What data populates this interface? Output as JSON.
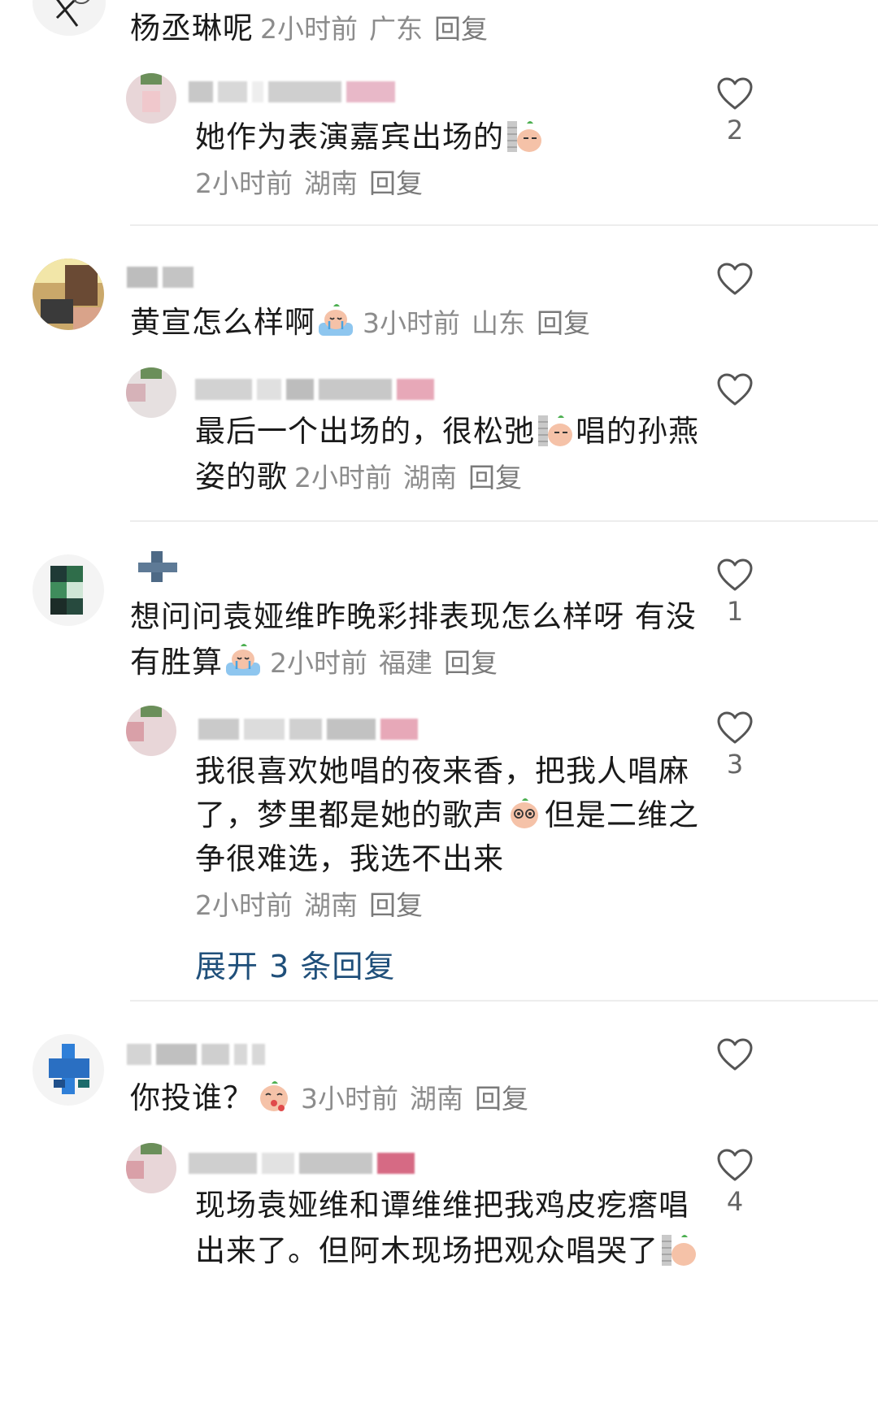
{
  "comments": [
    {
      "id": "c0",
      "text": "杨丞琳呢",
      "time": "2小时前",
      "location": "广东",
      "reply_label": "回复"
    },
    {
      "id": "r0",
      "text": "她作为表演嘉宾出场的",
      "emoji": "wall-peek-emoji",
      "time": "2小时前",
      "location": "湖南",
      "reply_label": "回复",
      "likes": "2"
    },
    {
      "id": "c1",
      "text": "黄宣怎么样啊",
      "emoji": "crying-bath-emoji",
      "time": "3小时前",
      "location": "山东",
      "reply_label": "回复"
    },
    {
      "id": "r1",
      "text_line1_a": "最后一个出场的，很松弛",
      "text_line1_b": "唱的孙燕",
      "text_line2": "姿的歌",
      "emoji": "wall-peek-emoji",
      "time": "2小时前",
      "location": "湖南",
      "reply_label": "回复"
    },
    {
      "id": "c2",
      "text_line1": "想问问袁娅维昨晚彩排表现怎么样呀 有没",
      "text_line2": "有胜算",
      "emoji": "crying-bath-emoji",
      "time": "2小时前",
      "location": "福建",
      "reply_label": "回复",
      "likes": "1"
    },
    {
      "id": "r2",
      "text_line1": "我很喜欢她唱的夜来香，把我人唱麻",
      "text_line2_a": "了，梦里都是她的歌声",
      "text_line2_b": "但是二维之",
      "text_line3": "争很难选，我选不出来",
      "emoji": "dizzy-eyes-emoji",
      "time": "2小时前",
      "location": "湖南",
      "reply_label": "回复",
      "likes": "3",
      "expand_label": "展开 3 条回复"
    },
    {
      "id": "c3",
      "text": "你投谁？",
      "emoji": "kiss-emoji",
      "time": "3小时前",
      "location": "湖南",
      "reply_label": "回复"
    },
    {
      "id": "r3",
      "text_line1": "现场袁娅维和谭维维把我鸡皮疙瘩唱",
      "text_line2": "出来了。但阿木现场把观众唱哭了",
      "emoji": "wall-peek-emoji",
      "likes": "4"
    }
  ],
  "colors": {
    "text": "#1a1a1a",
    "meta": "#8c8c8c",
    "link": "#1f4f7a",
    "divider": "#ededed",
    "heart_stroke": "#555555"
  },
  "icons": [
    "heart-outline-icon"
  ]
}
